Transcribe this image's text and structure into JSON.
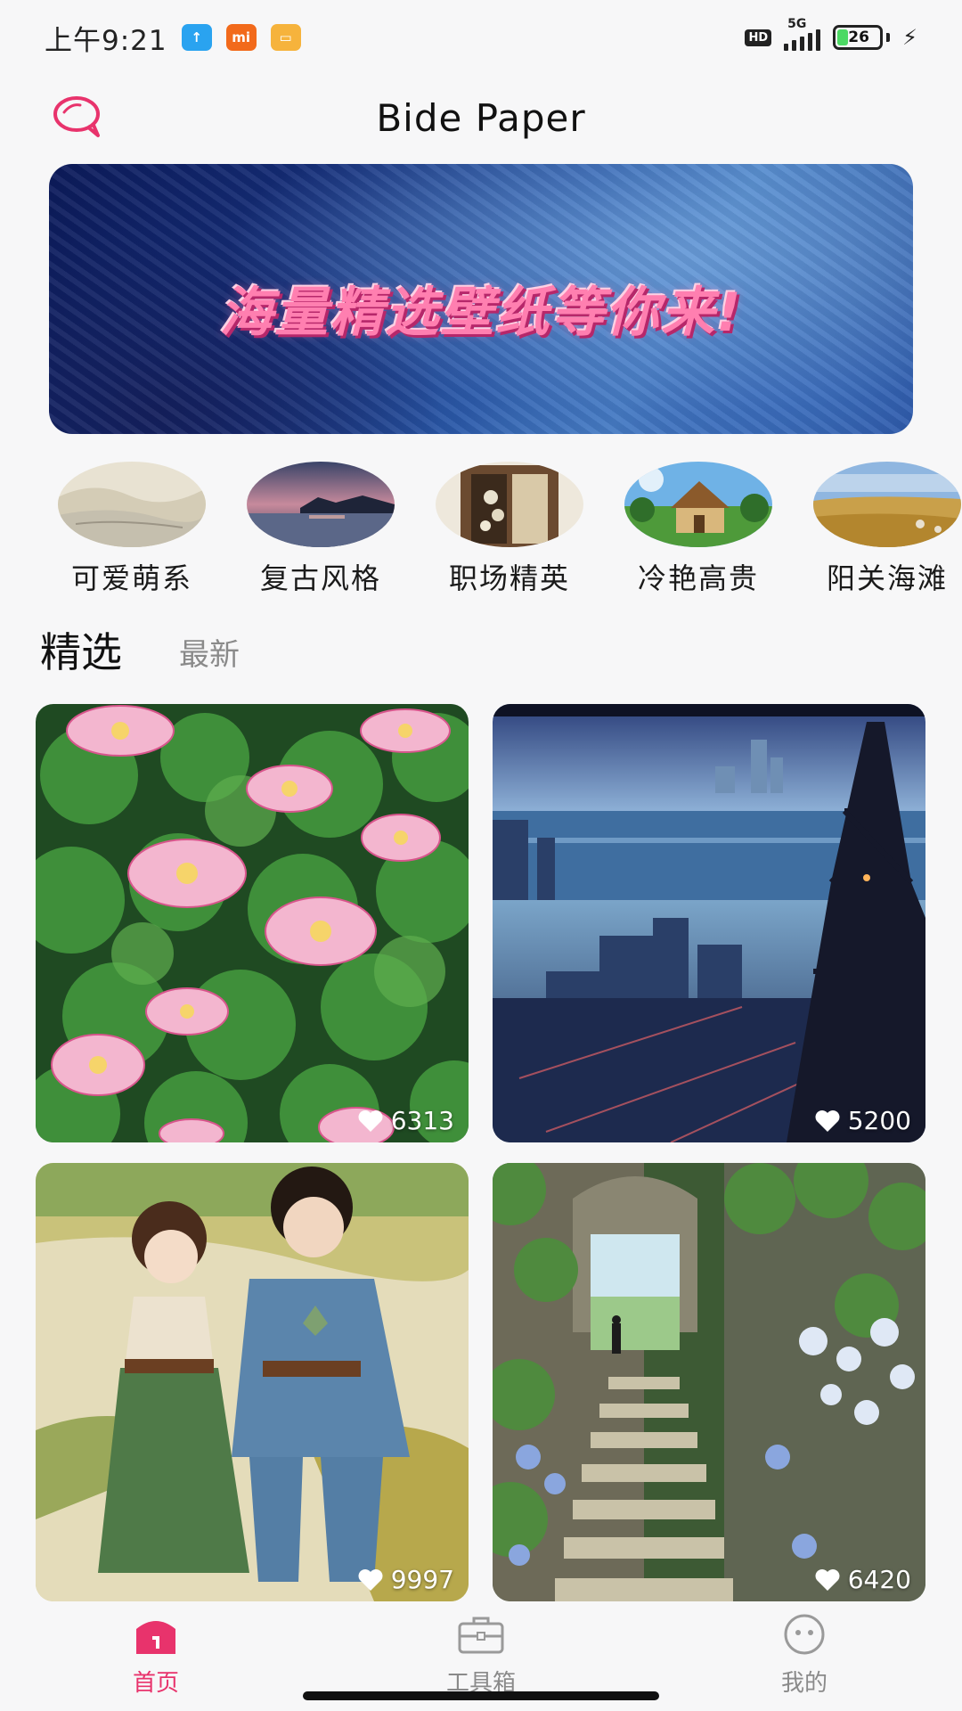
{
  "status_bar": {
    "time": "上午9:21",
    "hd": "HD",
    "network": "5G",
    "battery": "26",
    "battery_level": 26
  },
  "header": {
    "title": "Bide Paper"
  },
  "banner": {
    "text": "海量精选壁纸等你来!"
  },
  "categories": [
    {
      "label": "可爱萌系"
    },
    {
      "label": "复古风格"
    },
    {
      "label": "职场精英"
    },
    {
      "label": "冷艳高贵"
    },
    {
      "label": "阳关海滩"
    }
  ],
  "tabs": {
    "featured": "精选",
    "latest": "最新"
  },
  "cards": [
    {
      "likes": "6313"
    },
    {
      "likes": "5200"
    },
    {
      "likes": "9997"
    },
    {
      "likes": "6420"
    }
  ],
  "bottom_nav": {
    "home": "首页",
    "toolbox": "工具箱",
    "mine": "我的"
  },
  "colors": {
    "accent": "#e8336c",
    "inactive": "#8a8a8a"
  }
}
